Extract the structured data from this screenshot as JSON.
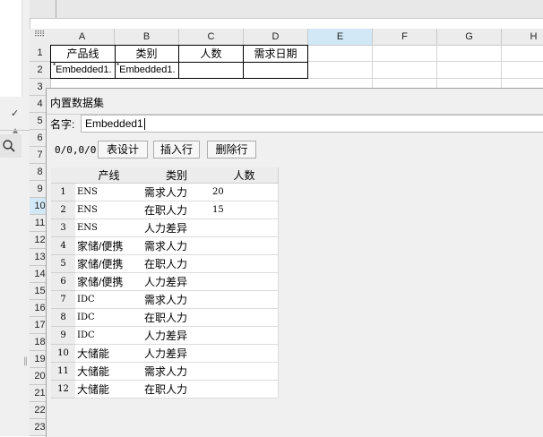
{
  "sheet": {
    "columns": [
      "A",
      "B",
      "C",
      "D",
      "E",
      "F",
      "G",
      "H"
    ],
    "selected_column": "E",
    "rows": [
      "1",
      "2",
      "3",
      "4",
      "5",
      "6",
      "7",
      "8",
      "9",
      "10",
      "11",
      "12",
      "13",
      "14",
      "15",
      "16",
      "17",
      "18",
      "19",
      "20",
      "21",
      "22",
      "23"
    ],
    "selected_row": "10",
    "header_cells": [
      "产品线",
      "类别",
      "人数",
      "需求日期"
    ],
    "data_cells": [
      "Embedded1.",
      "Embedded1."
    ]
  },
  "dialog": {
    "title": "内置数据集",
    "name_label": "名字:",
    "name_value": "Embedded1",
    "counter": "0/0,0/0",
    "buttons": {
      "table_design": "表设计",
      "insert_row": "插入行",
      "delete_row": "删除行"
    },
    "table": {
      "headers": [
        "产线",
        "类别",
        "人数"
      ],
      "rows": [
        {
          "index": "1",
          "line": "ENS",
          "category": "需求人力",
          "count": "20"
        },
        {
          "index": "2",
          "line": "ENS",
          "category": "在职人力",
          "count": "15"
        },
        {
          "index": "3",
          "line": "ENS",
          "category": "人力差异",
          "count": ""
        },
        {
          "index": "4",
          "line": "家储/便携",
          "category": "需求人力",
          "count": ""
        },
        {
          "index": "5",
          "line": "家储/便携",
          "category": "在职人力",
          "count": ""
        },
        {
          "index": "6",
          "line": "家储/便携",
          "category": "人力差异",
          "count": ""
        },
        {
          "index": "7",
          "line": "IDC",
          "category": "需求人力",
          "count": ""
        },
        {
          "index": "8",
          "line": "IDC",
          "category": "在职人力",
          "count": ""
        },
        {
          "index": "9",
          "line": "IDC",
          "category": "人力差异",
          "count": ""
        },
        {
          "index": "10",
          "line": "大储能",
          "category": "人力差异",
          "count": ""
        },
        {
          "index": "11",
          "line": "大储能",
          "category": "需求人力",
          "count": ""
        },
        {
          "index": "12",
          "line": "大储能",
          "category": "在职人力",
          "count": ""
        }
      ]
    }
  },
  "left_pane": {
    "check_glyph": "✓",
    "chevron_glyph": "▲",
    "splitter_glyph": "‖"
  },
  "colors": {
    "selected_header": "#d2e8f6",
    "header_bg": "#ececec",
    "dialog_bg": "#f0f0f0"
  }
}
